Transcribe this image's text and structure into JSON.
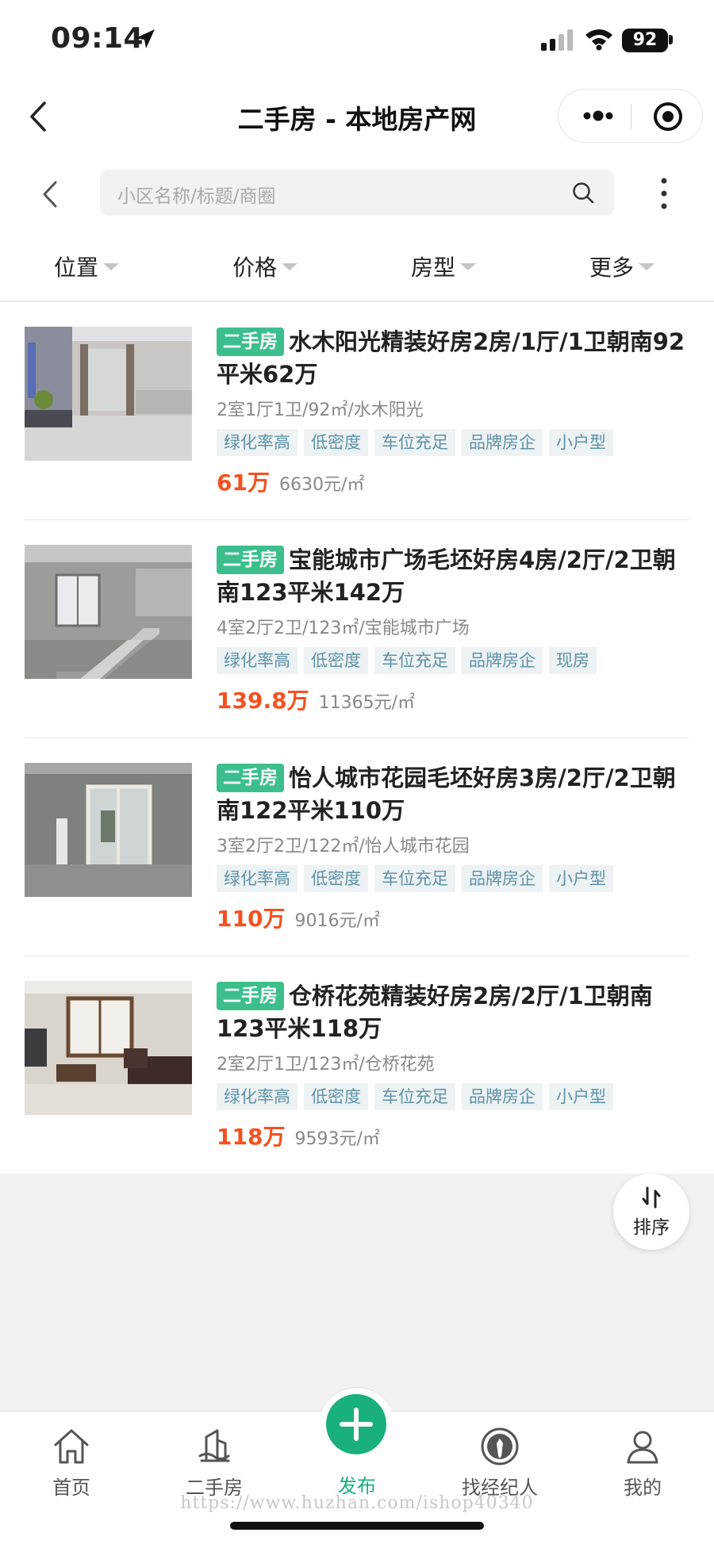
{
  "status": {
    "time": "09:14",
    "battery": "92"
  },
  "titlebar": {
    "title": "二手房 - 本地房产网"
  },
  "search": {
    "placeholder": "小区名称/标题/商圈"
  },
  "filters": [
    "位置",
    "价格",
    "房型",
    "更多"
  ],
  "listings": [
    {
      "type_tag": "二手房",
      "title": "水木阳光精装好房2房/1厅/1卫朝南92平米62万",
      "subtitle": "2室1厅1卫/92㎡/水木阳光",
      "tags": [
        "绿化率高",
        "低密度",
        "车位充足",
        "品牌房企",
        "小户型"
      ],
      "price": "61万",
      "unit_price": "6630元/㎡"
    },
    {
      "type_tag": "二手房",
      "title": "宝能城市广场毛坯好房4房/2厅/2卫朝南123平米142万",
      "subtitle": "4室2厅2卫/123㎡/宝能城市广场",
      "tags": [
        "绿化率高",
        "低密度",
        "车位充足",
        "品牌房企",
        "现房"
      ],
      "price": "139.8万",
      "unit_price": "11365元/㎡"
    },
    {
      "type_tag": "二手房",
      "title": "怡人城市花园毛坯好房3房/2厅/2卫朝南122平米110万",
      "subtitle": "3室2厅2卫/122㎡/怡人城市花园",
      "tags": [
        "绿化率高",
        "低密度",
        "车位充足",
        "品牌房企",
        "小户型"
      ],
      "price": "110万",
      "unit_price": "9016元/㎡"
    },
    {
      "type_tag": "二手房",
      "title": "仓桥花苑精装好房2房/2厅/1卫朝南123平米118万",
      "subtitle": "2室2厅1卫/123㎡/仓桥花苑",
      "tags": [
        "绿化率高",
        "低密度",
        "车位充足",
        "品牌房企",
        "小户型"
      ],
      "price": "118万",
      "unit_price": "9593元/㎡"
    }
  ],
  "sort": {
    "label": "排序"
  },
  "tabbar": {
    "tabs": [
      {
        "label": "首页",
        "icon": "home-icon"
      },
      {
        "label": "二手房",
        "icon": "building-icon"
      },
      {
        "label": "发布",
        "icon": "plus-icon"
      },
      {
        "label": "找经纪人",
        "icon": "agent-icon"
      },
      {
        "label": "我的",
        "icon": "user-icon"
      }
    ]
  },
  "watermark": "https://www.huzhan.com/ishop40340",
  "colors": {
    "accent": "#1ab07c",
    "price": "#f4511e",
    "type_tag": "#3cbf8c",
    "tag_bg": "#edf2f4",
    "tag_text": "#5d93a8"
  }
}
